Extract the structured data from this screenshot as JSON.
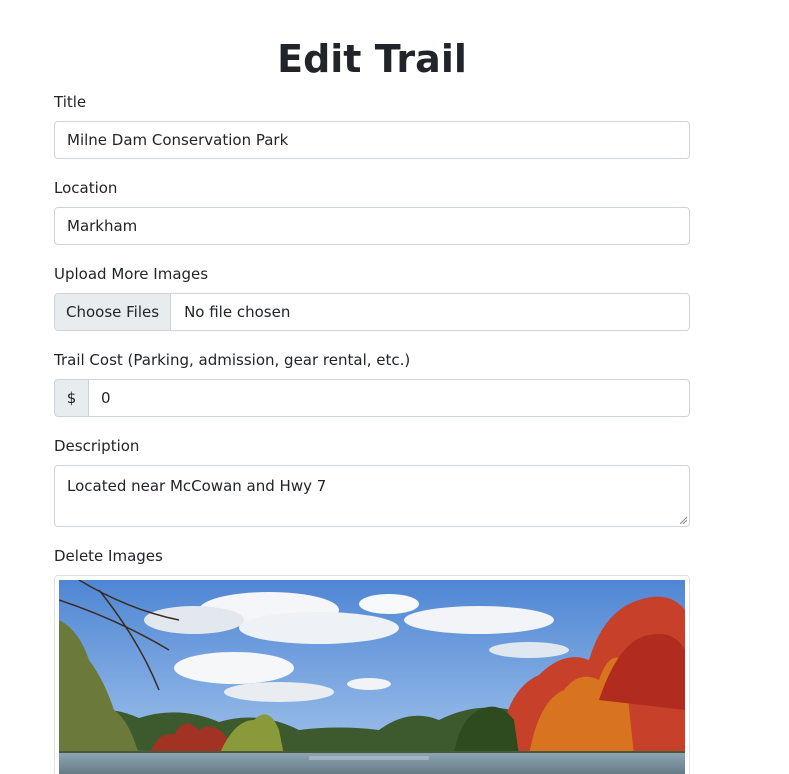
{
  "page": {
    "heading": "Edit Trail"
  },
  "form": {
    "title_label": "Title",
    "title_value": "Milne Dam Conservation Park",
    "location_label": "Location",
    "location_value": "Markham",
    "images_label": "Upload More Images",
    "choose_files_label": "Choose Files",
    "file_status": "No file chosen",
    "cost_label": "Trail Cost (Parking, admission, gear rental, etc.)",
    "cost_prefix": "$",
    "cost_value": "0",
    "description_label": "Description",
    "description_value": "Located near McCowan and Hwy 7",
    "delete_images_label": "Delete Images"
  },
  "icons": {
    "resize_handle": "textarea-resize-icon"
  }
}
